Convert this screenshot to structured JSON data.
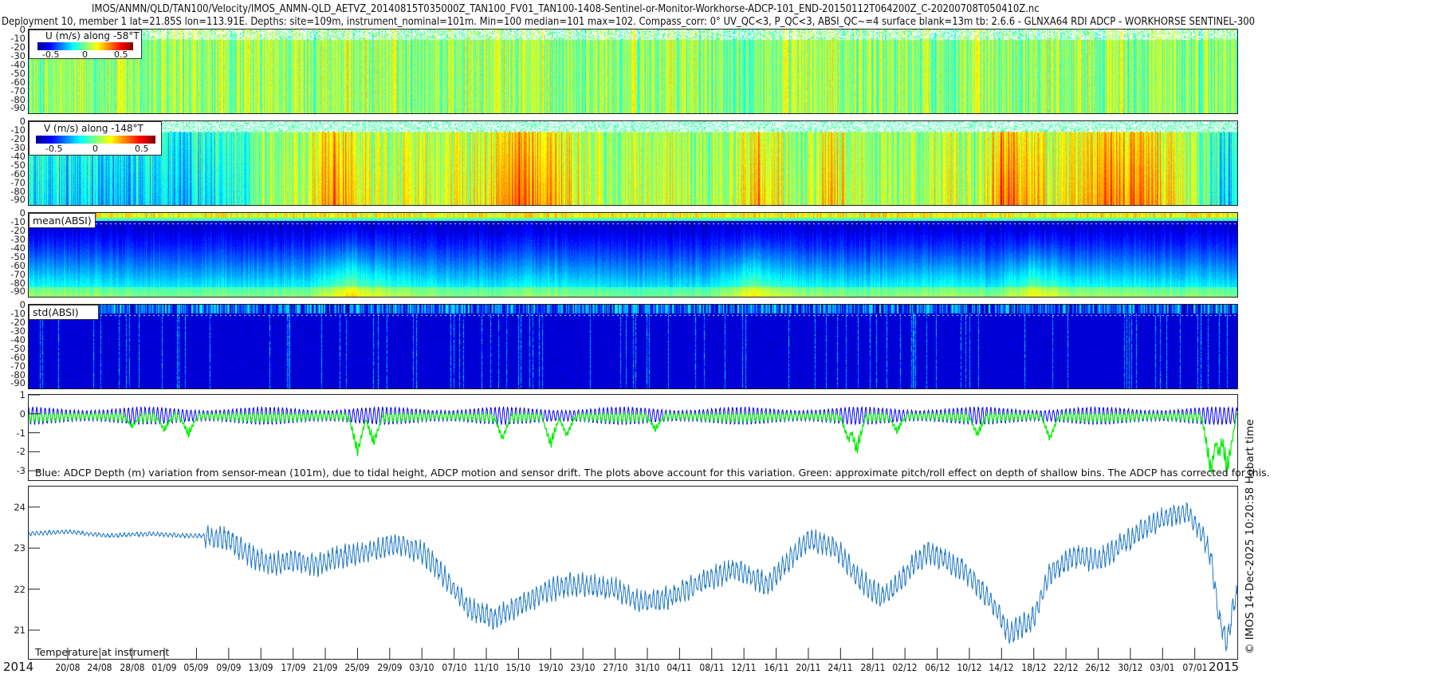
{
  "header": {
    "title_line1": "IMOS/ANMN/QLD/TAN100/Velocity/IMOS_ANMN-QLD_AETVZ_20140815T035000Z_TAN100_FV01_TAN100-1408-Sentinel-or-Monitor-Workhorse-ADCP-101_END-20150112T064200Z_C-20200708T050410Z.nc",
    "title_line2": "Deployment 10, member 1 lat=21.85S lon=113.91E. Depths: site=109m, instrument_nominal=101m. Min=100 median=101 max=102. Compass_corr: 0° UV_QC<3, P_QC<3, ABSI_QC~=4 surface blank=13m tb: 2.6.6 - GLNXA64 RDI ADCP - WORKHORSE SENTINEL-300"
  },
  "copyright": "© IMOS 14-Dec-2025 10:20:58 Hobart time",
  "colors": {
    "blue_line": "#0000ff",
    "green_line": "#00ee00",
    "temp_line": "#1f77c4",
    "axis": "#222222"
  },
  "chart_data": [
    {
      "type": "heatmap",
      "id": "u",
      "title": "U (m/s) along -58°T",
      "colorbar": {
        "range": [
          -0.7,
          0.7
        ],
        "ticks": [
          "-0.5",
          "0",
          "0.5"
        ]
      },
      "ylim": [
        0,
        -96
      ],
      "yticks": [
        "0",
        "-10",
        "-20",
        "-30",
        "-40",
        "-50",
        "-60",
        "-70",
        "-80",
        "-90"
      ],
      "profile_days": [
        0,
        10,
        20,
        30,
        40,
        50,
        60,
        70,
        80,
        90,
        100,
        110,
        120,
        130,
        140,
        150
      ],
      "profile_values": [
        0.0,
        0.02,
        0.0,
        0.03,
        0.05,
        0.02,
        0.04,
        0.02,
        0.03,
        0.02,
        0.04,
        0.02,
        0.03,
        0.05,
        0.0,
        0.02
      ]
    },
    {
      "type": "heatmap",
      "id": "v",
      "title": "V (m/s) along -148°T",
      "colorbar": {
        "range": [
          -0.7,
          0.7
        ],
        "ticks": [
          "-0.5",
          "0",
          "0.5"
        ]
      },
      "ylim": [
        0,
        -96
      ],
      "yticks": [
        "0",
        "-10",
        "-20",
        "-30",
        "-40",
        "-50",
        "-60",
        "-70",
        "-80",
        "-90"
      ],
      "profile_days": [
        0,
        5,
        10,
        15,
        20,
        25,
        30,
        35,
        38,
        41,
        44,
        47,
        52,
        57,
        60,
        63,
        66,
        69,
        72,
        76,
        80,
        84,
        88,
        91,
        94,
        97,
        100,
        103,
        106,
        110,
        114,
        118,
        121,
        124,
        128,
        131,
        134,
        137,
        140,
        143,
        145,
        147,
        149,
        150
      ],
      "profile_values": [
        -0.25,
        -0.3,
        -0.35,
        -0.3,
        -0.35,
        -0.2,
        0.05,
        0.15,
        0.45,
        0.3,
        0.1,
        0.2,
        0.15,
        0.25,
        0.5,
        0.45,
        0.35,
        0.15,
        0.05,
        0.1,
        0.15,
        0.05,
        0.1,
        0.4,
        0.15,
        0.1,
        0.35,
        0.1,
        0.05,
        0.1,
        0.15,
        0.05,
        0.55,
        0.4,
        0.15,
        0.3,
        0.45,
        0.45,
        0.4,
        0.2,
        0.05,
        -0.1,
        -0.35,
        -0.2
      ]
    },
    {
      "type": "heatmap",
      "id": "absi_mean",
      "title": "mean(ABSI)",
      "ylim": [
        0,
        -96
      ],
      "yticks": [
        "0",
        "-10",
        "-20",
        "-30",
        "-40",
        "-50",
        "-60",
        "-70",
        "-80",
        "-90"
      ],
      "profile_days": [
        0,
        15,
        25,
        35,
        40,
        45,
        55,
        65,
        75,
        85,
        90,
        95,
        105,
        115,
        120,
        125,
        130,
        140,
        150
      ],
      "profile_values": [
        0.4,
        0.3,
        0.3,
        0.35,
        0.7,
        0.45,
        0.3,
        0.35,
        0.25,
        0.3,
        0.65,
        0.4,
        0.3,
        0.4,
        0.3,
        0.65,
        0.4,
        0.35,
        0.3
      ]
    },
    {
      "type": "heatmap",
      "id": "absi_std",
      "title": "std(ABSI)",
      "ylim": [
        0,
        -96
      ],
      "yticks": [
        "0",
        "-10",
        "-20",
        "-30",
        "-40",
        "-50",
        "-60",
        "-70",
        "-80",
        "-90"
      ]
    },
    {
      "type": "line",
      "id": "depth",
      "ylim": [
        1,
        -3.5
      ],
      "yticks": [
        "1",
        "0",
        "-1",
        "-2",
        "-3"
      ],
      "annotation": "Blue: ADCP Depth (m) variation from sensor-mean (101m), due to tidal height, ADCP motion and sensor drift. The plots above account for this variation. Green: approximate pitch/roll effect on depth of shallow bins. The ADCP has corrected for this.",
      "series": [
        {
          "name": "ADCP depth variation",
          "color": "#0000ff",
          "mean": -0.1,
          "tidal_amplitude": [
            0.35,
            0.6
          ]
        },
        {
          "name": "pitch/roll effect",
          "color": "#00ee00",
          "spike_days": [
            13,
            17,
            20,
            41,
            43,
            59,
            65,
            67,
            78,
            102,
            103,
            108,
            118,
            127,
            147,
            148,
            149
          ],
          "spike_values": [
            -0.8,
            -1.0,
            -1.3,
            -2.3,
            -1.8,
            -1.5,
            -1.9,
            -1.3,
            -1.0,
            -1.6,
            -2.3,
            -1.1,
            -1.3,
            -1.5,
            -3.5,
            -2.5,
            -3.5
          ]
        }
      ]
    },
    {
      "type": "line",
      "id": "temperature",
      "title": "Temperature at instrument",
      "ylim": [
        20.3,
        24.5
      ],
      "yticks": [
        "24",
        "23",
        "22",
        "21"
      ],
      "x_days": [
        0,
        5,
        10,
        15,
        20,
        22,
        25,
        27,
        30,
        33,
        36,
        39,
        42,
        46,
        49,
        51,
        53,
        55,
        58,
        61,
        64,
        67,
        70,
        73,
        76,
        78,
        81,
        84,
        88,
        90,
        92,
        94,
        97,
        99,
        101,
        103,
        106,
        108,
        110,
        112,
        114,
        116,
        118,
        120,
        122,
        125,
        127,
        130,
        133,
        136,
        139,
        142,
        144,
        146,
        147,
        148,
        149,
        150
      ],
      "values": [
        23.35,
        23.4,
        23.3,
        23.35,
        23.3,
        23.3,
        23.2,
        22.9,
        22.6,
        22.7,
        22.6,
        22.8,
        22.9,
        23.1,
        22.9,
        22.5,
        22.0,
        21.5,
        21.3,
        21.6,
        21.9,
        22.1,
        22.1,
        22.0,
        21.7,
        21.7,
        21.9,
        22.2,
        22.5,
        22.3,
        22.1,
        22.6,
        23.2,
        23.1,
        22.9,
        22.3,
        21.8,
        22.1,
        22.6,
        22.9,
        22.7,
        22.5,
        22.1,
        21.6,
        20.9,
        21.3,
        22.4,
        22.8,
        22.7,
        23.1,
        23.5,
        23.8,
        23.9,
        23.3,
        22.8,
        21.3,
        20.7,
        21.8
      ]
    },
    {
      "type": "axis",
      "id": "time_axis",
      "xlim_days_from_2014_08_15": [
        0.16,
        150.28
      ],
      "year_start": "2014",
      "year_end": "2015",
      "tick_labels": [
        "20/08",
        "24/08",
        "28/08",
        "01/09",
        "05/09",
        "09/09",
        "13/09",
        "17/09",
        "21/09",
        "25/09",
        "29/09",
        "03/10",
        "07/10",
        "11/10",
        "15/10",
        "19/10",
        "23/10",
        "27/10",
        "31/10",
        "04/11",
        "08/11",
        "12/11",
        "16/11",
        "20/11",
        "24/11",
        "28/11",
        "02/12",
        "06/12",
        "10/12",
        "14/12",
        "18/12",
        "22/12",
        "26/12",
        "30/12",
        "03/01",
        "07/01"
      ],
      "tick_days": [
        5,
        9,
        13,
        17,
        21,
        25,
        29,
        33,
        37,
        41,
        45,
        49,
        53,
        57,
        61,
        65,
        69,
        73,
        77,
        81,
        85,
        89,
        93,
        97,
        101,
        105,
        109,
        113,
        117,
        121,
        125,
        129,
        133,
        137,
        141,
        145
      ]
    }
  ]
}
